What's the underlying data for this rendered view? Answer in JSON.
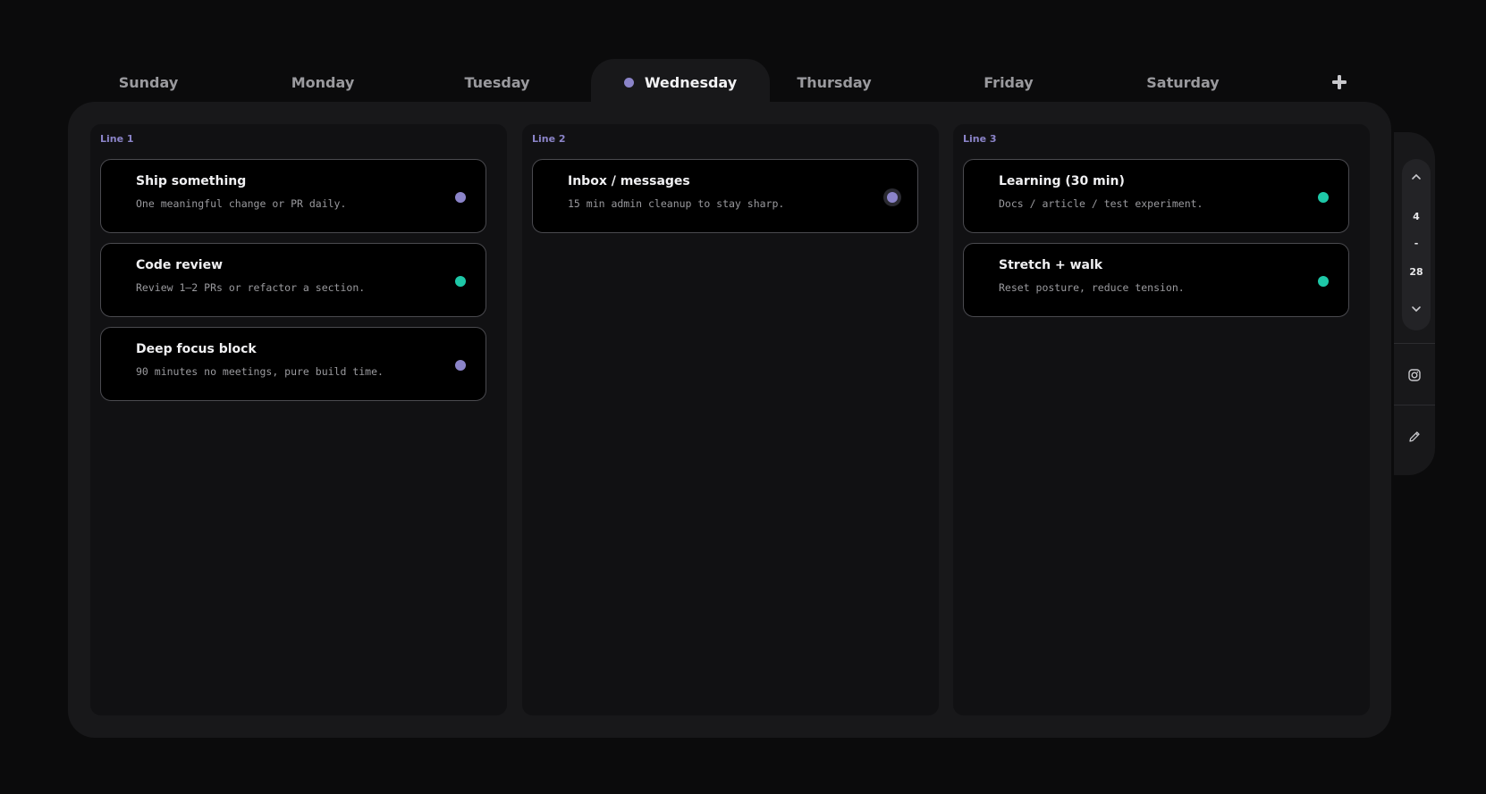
{
  "tabs": [
    {
      "label": "Sunday"
    },
    {
      "label": "Monday"
    },
    {
      "label": "Tuesday"
    },
    {
      "label": "Wednesday",
      "active": true
    },
    {
      "label": "Thursday"
    },
    {
      "label": "Friday"
    },
    {
      "label": "Saturday"
    }
  ],
  "add_icon": "plus-icon",
  "columns": [
    {
      "label": "Line 1",
      "cards": [
        {
          "title": "Ship something",
          "subtitle": "One meaningful change or PR daily.",
          "status_color": "#8b84c9"
        },
        {
          "title": "Code review",
          "subtitle": "Review 1–2 PRs or refactor a section.",
          "status_color": "#1ec8a8"
        },
        {
          "title": "Deep focus block",
          "subtitle": "90 minutes no meetings, pure build time.",
          "status_color": "#8b84c9"
        }
      ]
    },
    {
      "label": "Line 2",
      "cards": [
        {
          "title": "Inbox / messages",
          "subtitle": "15 min admin cleanup to stay sharp.",
          "status_color": "#8b84c9"
        }
      ]
    },
    {
      "label": "Line 3",
      "cards": [
        {
          "title": "Learning (30 min)",
          "subtitle": "Docs / article / test experiment.",
          "status_color": "#1ec8a8"
        },
        {
          "title": "Stretch + walk",
          "subtitle": "Reset posture, reduce tension.",
          "status_color": "#1ec8a8"
        }
      ]
    }
  ],
  "pager": {
    "start": "4",
    "separator": "-",
    "end": "28"
  },
  "sidebar_icons": [
    "instagram-icon",
    "pencil-icon"
  ],
  "colors": {
    "accent": "#8b84c9",
    "teal": "#1ec8a8",
    "board": "#18181a",
    "column": "#111113"
  }
}
